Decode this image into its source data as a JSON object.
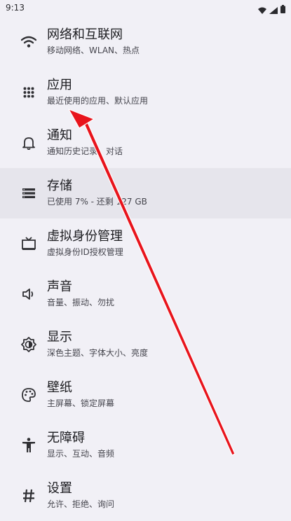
{
  "status": {
    "time": "9:13"
  },
  "settings": {
    "items": [
      {
        "icon": "wifi-icon",
        "title": "网络和互联网",
        "subtitle": "移动网络、WLAN、热点",
        "highlighted": false
      },
      {
        "icon": "apps-grid-icon",
        "title": "应用",
        "subtitle": "最近使用的应用、默认应用",
        "highlighted": false
      },
      {
        "icon": "bell-icon",
        "title": "通知",
        "subtitle": "通知历史记录、对话",
        "highlighted": false
      },
      {
        "icon": "storage-icon",
        "title": "存储",
        "subtitle": "已使用 7% - 还剩 127 GB",
        "highlighted": true
      },
      {
        "icon": "tv-icon",
        "title": "虚拟身份管理",
        "subtitle": "虚拟身份ID授权管理",
        "highlighted": false
      },
      {
        "icon": "speaker-icon",
        "title": "声音",
        "subtitle": "音量、振动、勿扰",
        "highlighted": false
      },
      {
        "icon": "brightness-icon",
        "title": "显示",
        "subtitle": "深色主题、字体大小、亮度",
        "highlighted": false
      },
      {
        "icon": "palette-icon",
        "title": "壁纸",
        "subtitle": "主屏幕、锁定屏幕",
        "highlighted": false
      },
      {
        "icon": "accessibility-icon",
        "title": "无障碍",
        "subtitle": "显示、互动、音频",
        "highlighted": false
      },
      {
        "icon": "hash-icon",
        "title": "设置",
        "subtitle": "允许、拒绝、询问",
        "highlighted": false
      }
    ]
  },
  "colors": {
    "background": "#f1f0f6",
    "highlight": "#e6e5ec",
    "arrow": "#e8141c"
  }
}
